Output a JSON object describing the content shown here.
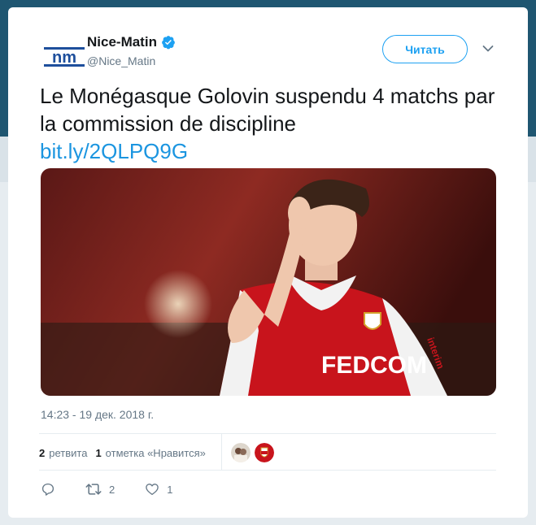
{
  "account": {
    "logo_text": "nm",
    "display_name": "Nice-Matin",
    "handle": "@Nice_Matin",
    "verified_icon": "verified-badge-icon"
  },
  "header": {
    "follow_label": "Читать",
    "menu_icon": "chevron-down-icon"
  },
  "tweet": {
    "text": "Le Monégasque Golovin suspendu 4 matchs par la commission de discipline",
    "link": "bit.ly/2QLPQ9G",
    "image_jersey_text": "FEDCOM",
    "image_sleeve_text": "interim"
  },
  "meta": {
    "timestamp": "14:23 - 19 дек. 2018 г."
  },
  "stats": {
    "retweet_count": "2",
    "retweet_label": "ретвита",
    "like_count": "1",
    "like_label": "отметка «Нравится»"
  },
  "actions": {
    "reply_icon": "reply-icon",
    "retweet_icon": "retweet-icon",
    "retweet_count": "2",
    "like_icon": "heart-icon",
    "like_count": "1"
  },
  "colors": {
    "accent": "#1da1f2",
    "link": "#1b95e0",
    "header_bg": "#1f5671"
  }
}
